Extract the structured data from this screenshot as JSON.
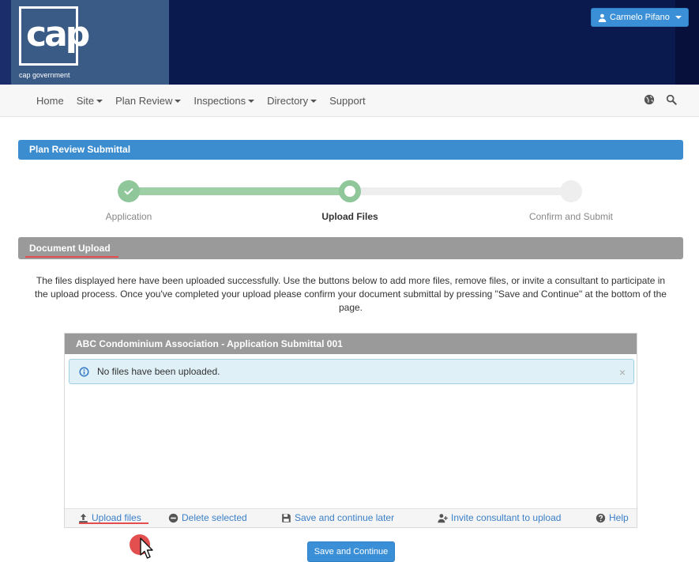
{
  "header": {
    "logo_text": "cap",
    "logo_caption": "cap government",
    "user_name": "Carmelo Pifano"
  },
  "nav": {
    "items": [
      {
        "label": "Home",
        "dropdown": false
      },
      {
        "label": "Site",
        "dropdown": true
      },
      {
        "label": "Plan Review",
        "dropdown": true
      },
      {
        "label": "Inspections",
        "dropdown": true
      },
      {
        "label": "Directory",
        "dropdown": true
      },
      {
        "label": "Support",
        "dropdown": false
      }
    ],
    "icons": [
      "globe-icon",
      "search-icon"
    ]
  },
  "panel": {
    "title": "Plan Review Submittal"
  },
  "stepper": {
    "steps": [
      {
        "label": "Application",
        "state": "complete"
      },
      {
        "label": "Upload Files",
        "state": "current"
      },
      {
        "label": "Confirm and Submit",
        "state": "pending"
      }
    ]
  },
  "upload_section": {
    "title": "Document Upload",
    "description": "The files displayed here have been uploaded successfully. Use the buttons below to add more files, remove files, or invite a consultant to participate in the upload process. Once you've completed your upload please confirm your document submittal by pressing \"Save and Continue\" at the bottom of the page."
  },
  "card": {
    "title": "ABC Condominium Association - Application Submittal 001",
    "alert_text": "No files have been uploaded.",
    "alert_close": "×",
    "actions": {
      "upload": "Upload files",
      "delete": "Delete selected",
      "save_later": "Save and continue later",
      "invite": "Invite consultant to upload",
      "help": "Help"
    }
  },
  "buttons": {
    "save_continue": "Save and Continue"
  },
  "colors": {
    "header_bg": "#0b1a4e",
    "brand_panel": "#3a5b86",
    "primary": "#3a8fd6",
    "step_complete": "#8fc79a",
    "panel_gray": "#9a9a9a",
    "alert_bg": "#dff0f7",
    "highlight_red": "#e34d4d"
  }
}
